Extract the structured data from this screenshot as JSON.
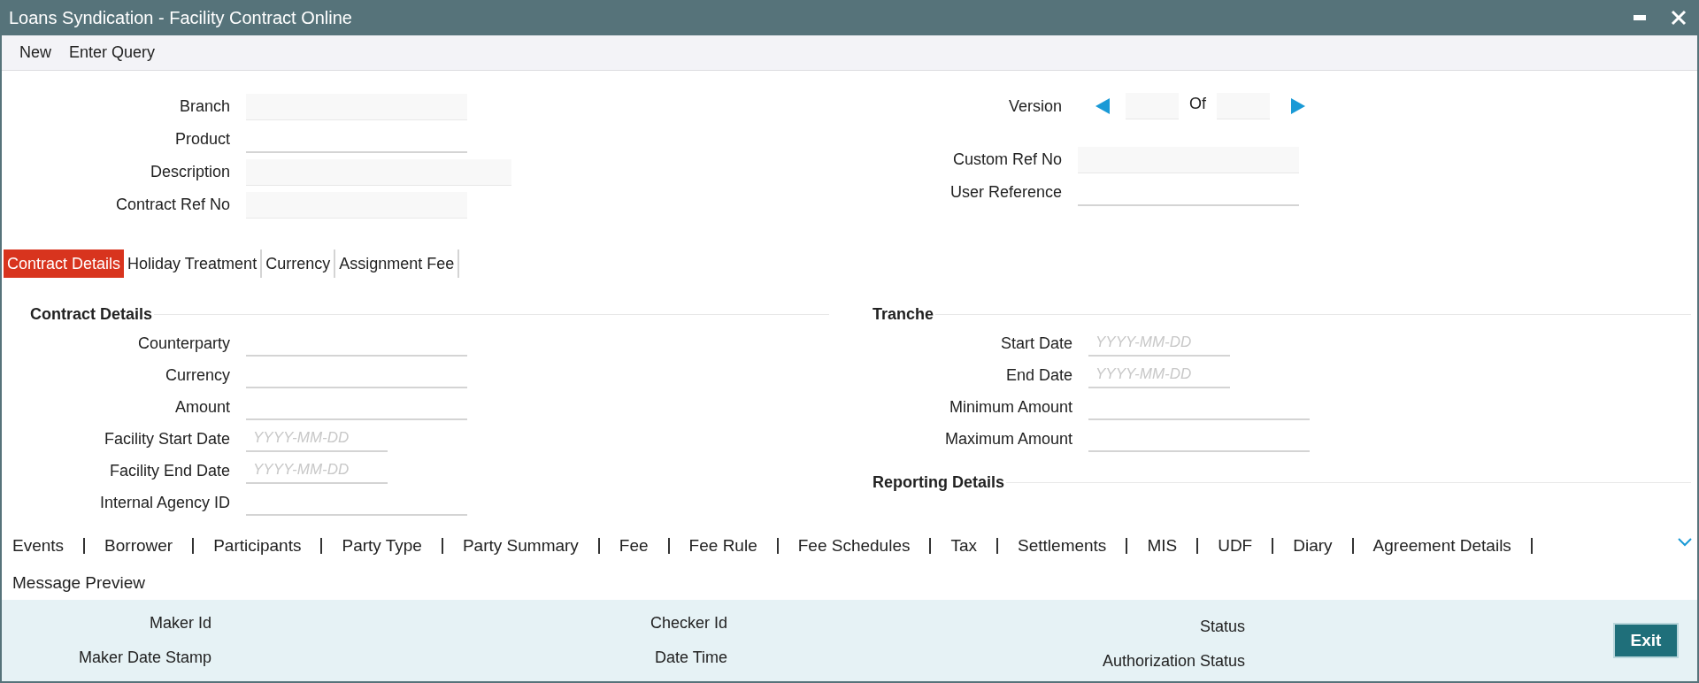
{
  "window": {
    "title": "Loans Syndication - Facility Contract Online"
  },
  "menu": [
    "New",
    "Enter Query"
  ],
  "header": {
    "left_fields": [
      {
        "label": "Branch",
        "kind": "readonly"
      },
      {
        "label": "Product",
        "kind": "text"
      },
      {
        "label": "Description",
        "kind": "wide"
      },
      {
        "label": "Contract Ref No",
        "kind": "readonly"
      }
    ],
    "version": {
      "label": "Version",
      "of": "Of"
    },
    "right_fields": [
      {
        "label": "Custom Ref No",
        "kind": "readonly"
      },
      {
        "label": "User Reference",
        "kind": "text"
      }
    ]
  },
  "tabs": [
    {
      "label": "Contract Details",
      "selected": true
    },
    {
      "label": "Holiday Treatment",
      "selected": false
    },
    {
      "label": "Currency",
      "selected": false
    },
    {
      "label": "Assignment Fee",
      "selected": false
    }
  ],
  "sections": [
    {
      "title": "Contract Details",
      "fields": [
        {
          "label": "Counterparty",
          "kind": "text"
        },
        {
          "label": "Currency",
          "kind": "text"
        },
        {
          "label": "Amount",
          "kind": "text"
        },
        {
          "label": "Facility Start Date",
          "kind": "date",
          "placeholder": "YYYY-MM-DD"
        },
        {
          "label": "Facility End Date",
          "kind": "date",
          "placeholder": "YYYY-MM-DD"
        },
        {
          "label": "Internal Agency ID",
          "kind": "text"
        }
      ]
    },
    {
      "title": "Tranche",
      "fields": [
        {
          "label": "Start Date",
          "kind": "date",
          "placeholder": "YYYY-MM-DD"
        },
        {
          "label": "End Date",
          "kind": "date",
          "placeholder": "YYYY-MM-DD"
        },
        {
          "label": "Minimum Amount",
          "kind": "text"
        },
        {
          "label": "Maximum Amount",
          "kind": "text"
        }
      ]
    },
    {
      "title": "Reporting Details"
    }
  ],
  "links": [
    "Events",
    "Borrower",
    "Participants",
    "Party Type",
    "Party Summary",
    "Fee",
    "Fee Rule",
    "Fee Schedules",
    "Tax",
    "Settlements",
    "MIS",
    "UDF",
    "Diary",
    "Agreement Details",
    "Message Preview"
  ],
  "footer": {
    "columns": [
      [
        "Maker Id",
        "Maker Date Stamp"
      ],
      [
        "Checker Id",
        "Date Time"
      ],
      [
        "Status",
        "Authorization Status"
      ]
    ],
    "exit": "Exit"
  }
}
